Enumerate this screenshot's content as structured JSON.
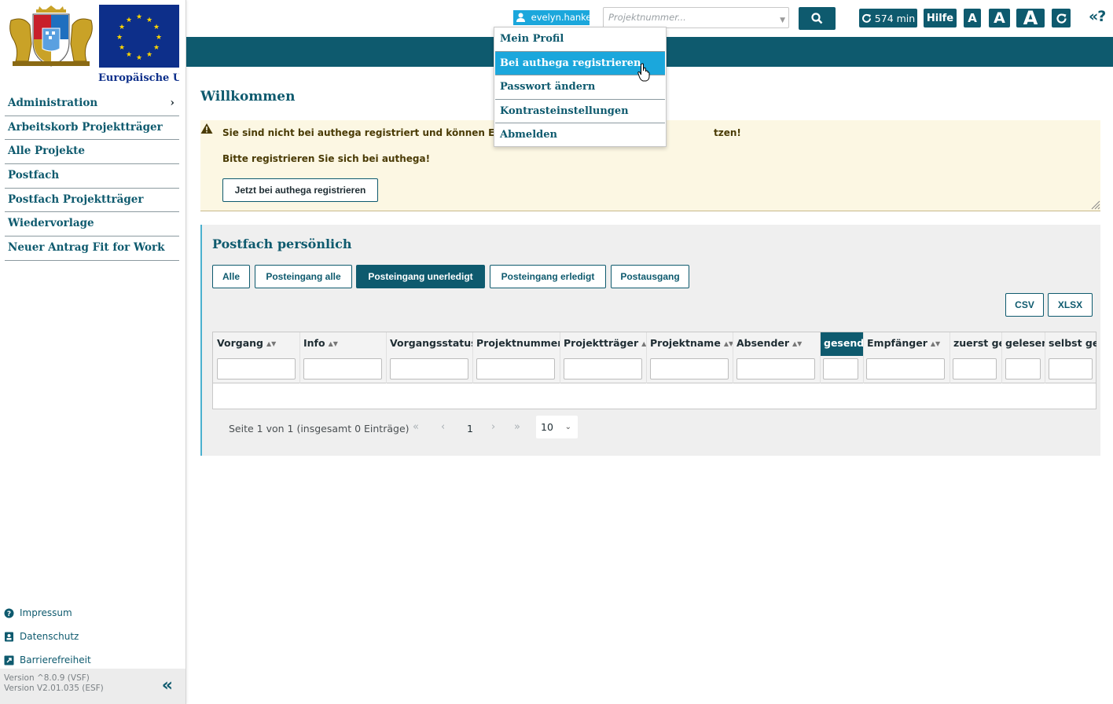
{
  "sidebar": {
    "eu_caption": "Europäische Union",
    "nav": [
      {
        "label": "Administration",
        "has_submenu": true
      },
      {
        "label": "Arbeitskorb Projektträger"
      },
      {
        "label": "Alle Projekte"
      },
      {
        "label": "Postfach"
      },
      {
        "label": "Postfach Projektträger"
      },
      {
        "label": "Wiedervorlage"
      },
      {
        "label": "Neuer Antrag Fit for Work"
      }
    ],
    "footer_links": [
      {
        "label": "Impressum",
        "icon": "question-circle-icon"
      },
      {
        "label": "Datenschutz",
        "icon": "id-badge-icon"
      },
      {
        "label": "Barrierefreiheit",
        "icon": "external-link-icon"
      }
    ],
    "version_line1": "Version ^8.0.9 (VSF)",
    "version_line2": "Version V2.01.035 (ESF)",
    "collapse_symbol": "«"
  },
  "topbar": {
    "username": "evelyn.hankele",
    "project_placeholder": "Projektnummer...",
    "timer_label": "574 min",
    "help_label": "Hilfe",
    "font_small": "A",
    "font_medium": "A",
    "font_large": "A",
    "nav_toggle": "«?"
  },
  "user_menu": {
    "items": [
      "Mein Profil",
      "Bei authega registrieren",
      "Passwort ändern",
      "Kontrasteinstellungen",
      "Abmelden"
    ],
    "hovered_index": 1
  },
  "main": {
    "welcome": "Willkommen",
    "alert": {
      "line1_start": "Sie sind nicht bei authega registriert und können ESF-Bava",
      "line1_end": "tzen!",
      "line2": "Bitte registrieren Sie sich bei authega!",
      "button": "Jetzt bei authega registrieren"
    },
    "mailbox": {
      "title": "Postfach persönlich",
      "filters": [
        "Alle",
        "Posteingang alle",
        "Posteingang unerledigt",
        "Posteingang erledigt",
        "Postausgang"
      ],
      "active_filter": "Posteingang unerledigt",
      "export_csv": "CSV",
      "export_xlsx": "XLSX",
      "columns": [
        "Vorgang",
        "Info",
        "Vorgangsstatus",
        "Projektnummer",
        "Projektträger",
        "Projektname",
        "Absender",
        "gesendet",
        "Empfänger",
        "zuerst gel",
        "gelesen",
        "selbst gel"
      ],
      "sorted_column": "gesendet",
      "pager": {
        "info": "Seite 1 von 1 (insgesamt 0 Einträge)",
        "first": "«",
        "prev": "‹",
        "current": "1",
        "next": "›",
        "last": "»",
        "page_size": "10"
      }
    }
  },
  "colors": {
    "primary": "#0e5a6e",
    "accent": "#1ba7dc",
    "alert_bg": "#fcf7e3",
    "panel_bg": "#efefef"
  }
}
